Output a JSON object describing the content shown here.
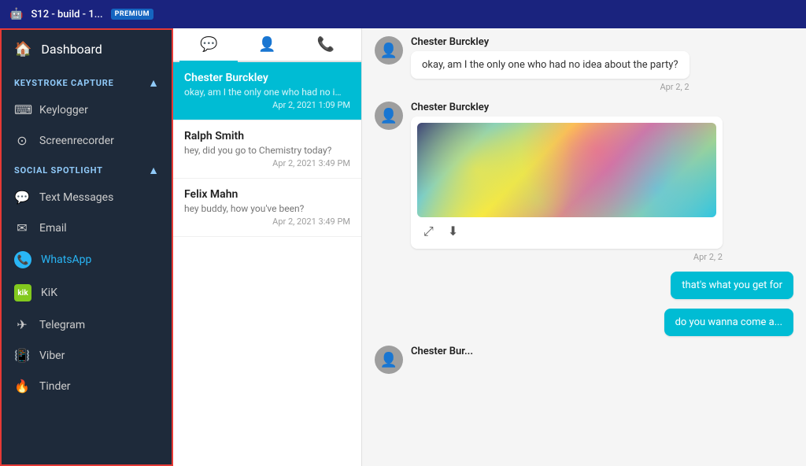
{
  "topbar": {
    "android_icon": "🤖",
    "title": "S12 - build - 1...",
    "badge": "PREMIUM"
  },
  "sidebar": {
    "dashboard_label": "Dashboard",
    "keystroke_section": "KEYSTROKE CAPTURE",
    "keylogger_label": "Keylogger",
    "screenrecorder_label": "Screenrecorder",
    "social_section": "SOCIAL SPOTLIGHT",
    "items": [
      {
        "id": "text-messages",
        "label": "Text Messages",
        "icon": "💬"
      },
      {
        "id": "email",
        "label": "Email",
        "icon": "✉"
      },
      {
        "id": "whatsapp",
        "label": "WhatsApp",
        "icon": "📞",
        "active": true
      },
      {
        "id": "kik",
        "label": "KiK",
        "icon": "kik"
      },
      {
        "id": "telegram",
        "label": "Telegram",
        "icon": "✈"
      },
      {
        "id": "viber",
        "label": "Viber",
        "icon": "📳"
      },
      {
        "id": "tinder",
        "label": "Tinder",
        "icon": "🔥"
      }
    ]
  },
  "conversation_tabs": [
    {
      "id": "messages",
      "icon": "💬",
      "active": true
    },
    {
      "id": "contacts",
      "icon": "👤"
    },
    {
      "id": "calls",
      "icon": "📞"
    }
  ],
  "conversations": [
    {
      "id": "chester",
      "name": "Chester Burckley",
      "preview": "okay, am I the only one who had no i...",
      "time": "Apr 2, 2021 1:09 PM",
      "active": true
    },
    {
      "id": "ralph",
      "name": "Ralph Smith",
      "preview": "hey, did you go to Chemistry today?",
      "time": "Apr 2, 2021 3:49 PM",
      "active": false
    },
    {
      "id": "felix",
      "name": "Felix Mahn",
      "preview": "hey buddy, how you've been?",
      "time": "Apr 2, 2021 3:49 PM",
      "active": false
    }
  ],
  "messages": [
    {
      "id": "msg1",
      "sender": "Chester Burckley",
      "text": "okay, am I the only one who had no idea about the party?",
      "time": "Apr 2, 2",
      "type": "text",
      "outgoing": false
    },
    {
      "id": "msg2",
      "sender": "Chester Burckley",
      "text": "",
      "time": "Apr 2, 2",
      "type": "image",
      "outgoing": false
    },
    {
      "id": "msg3",
      "sender": "",
      "text": "that's what you get for",
      "time": "",
      "type": "text",
      "outgoing": true
    },
    {
      "id": "msg4",
      "sender": "",
      "text": "do you wanna come a...",
      "time": "",
      "type": "text",
      "outgoing": true
    }
  ]
}
